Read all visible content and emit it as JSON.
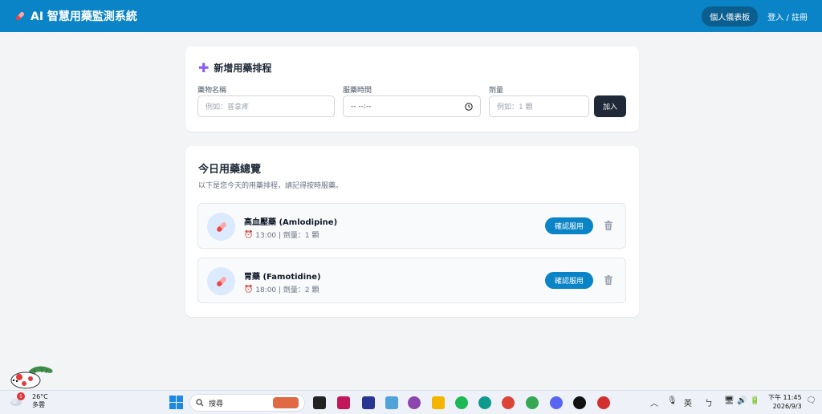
{
  "header": {
    "title": "AI 智慧用藥監測系統",
    "dashboard_label": "個人儀表板",
    "login_label": "登入 / 註冊"
  },
  "add_form": {
    "title": "新增用藥排程",
    "name_label": "藥物名稱",
    "name_placeholder": "例如：普拿疼",
    "time_label": "服藥時間",
    "time_value": "-- --:--",
    "dose_label": "劑量",
    "dose_placeholder": "例如：1 顆",
    "add_label": "加入"
  },
  "overview": {
    "title": "今日用藥總覽",
    "subtitle": "以下是您今天的用藥排程，請記得按時服藥。",
    "items": [
      {
        "name": "高血壓藥 (Amlodipine)",
        "detail": "13:00 | 劑量：1 顆",
        "confirm_label": "確認服用"
      },
      {
        "name": "胃藥 (Famotidine)",
        "detail": "18:00 | 劑量：2 顆",
        "confirm_label": "確認服用"
      }
    ]
  },
  "taskbar": {
    "weather_badge": "5",
    "temperature": "26°C",
    "condition": "多雲",
    "search_placeholder": "搜尋",
    "ime_label": "英",
    "time": "下午 11:45",
    "date": "2026/9/3"
  },
  "colors": {
    "primary": "#0a84c6",
    "dark_button": "#1f2937",
    "plus_accent": "#8b5cf6"
  }
}
